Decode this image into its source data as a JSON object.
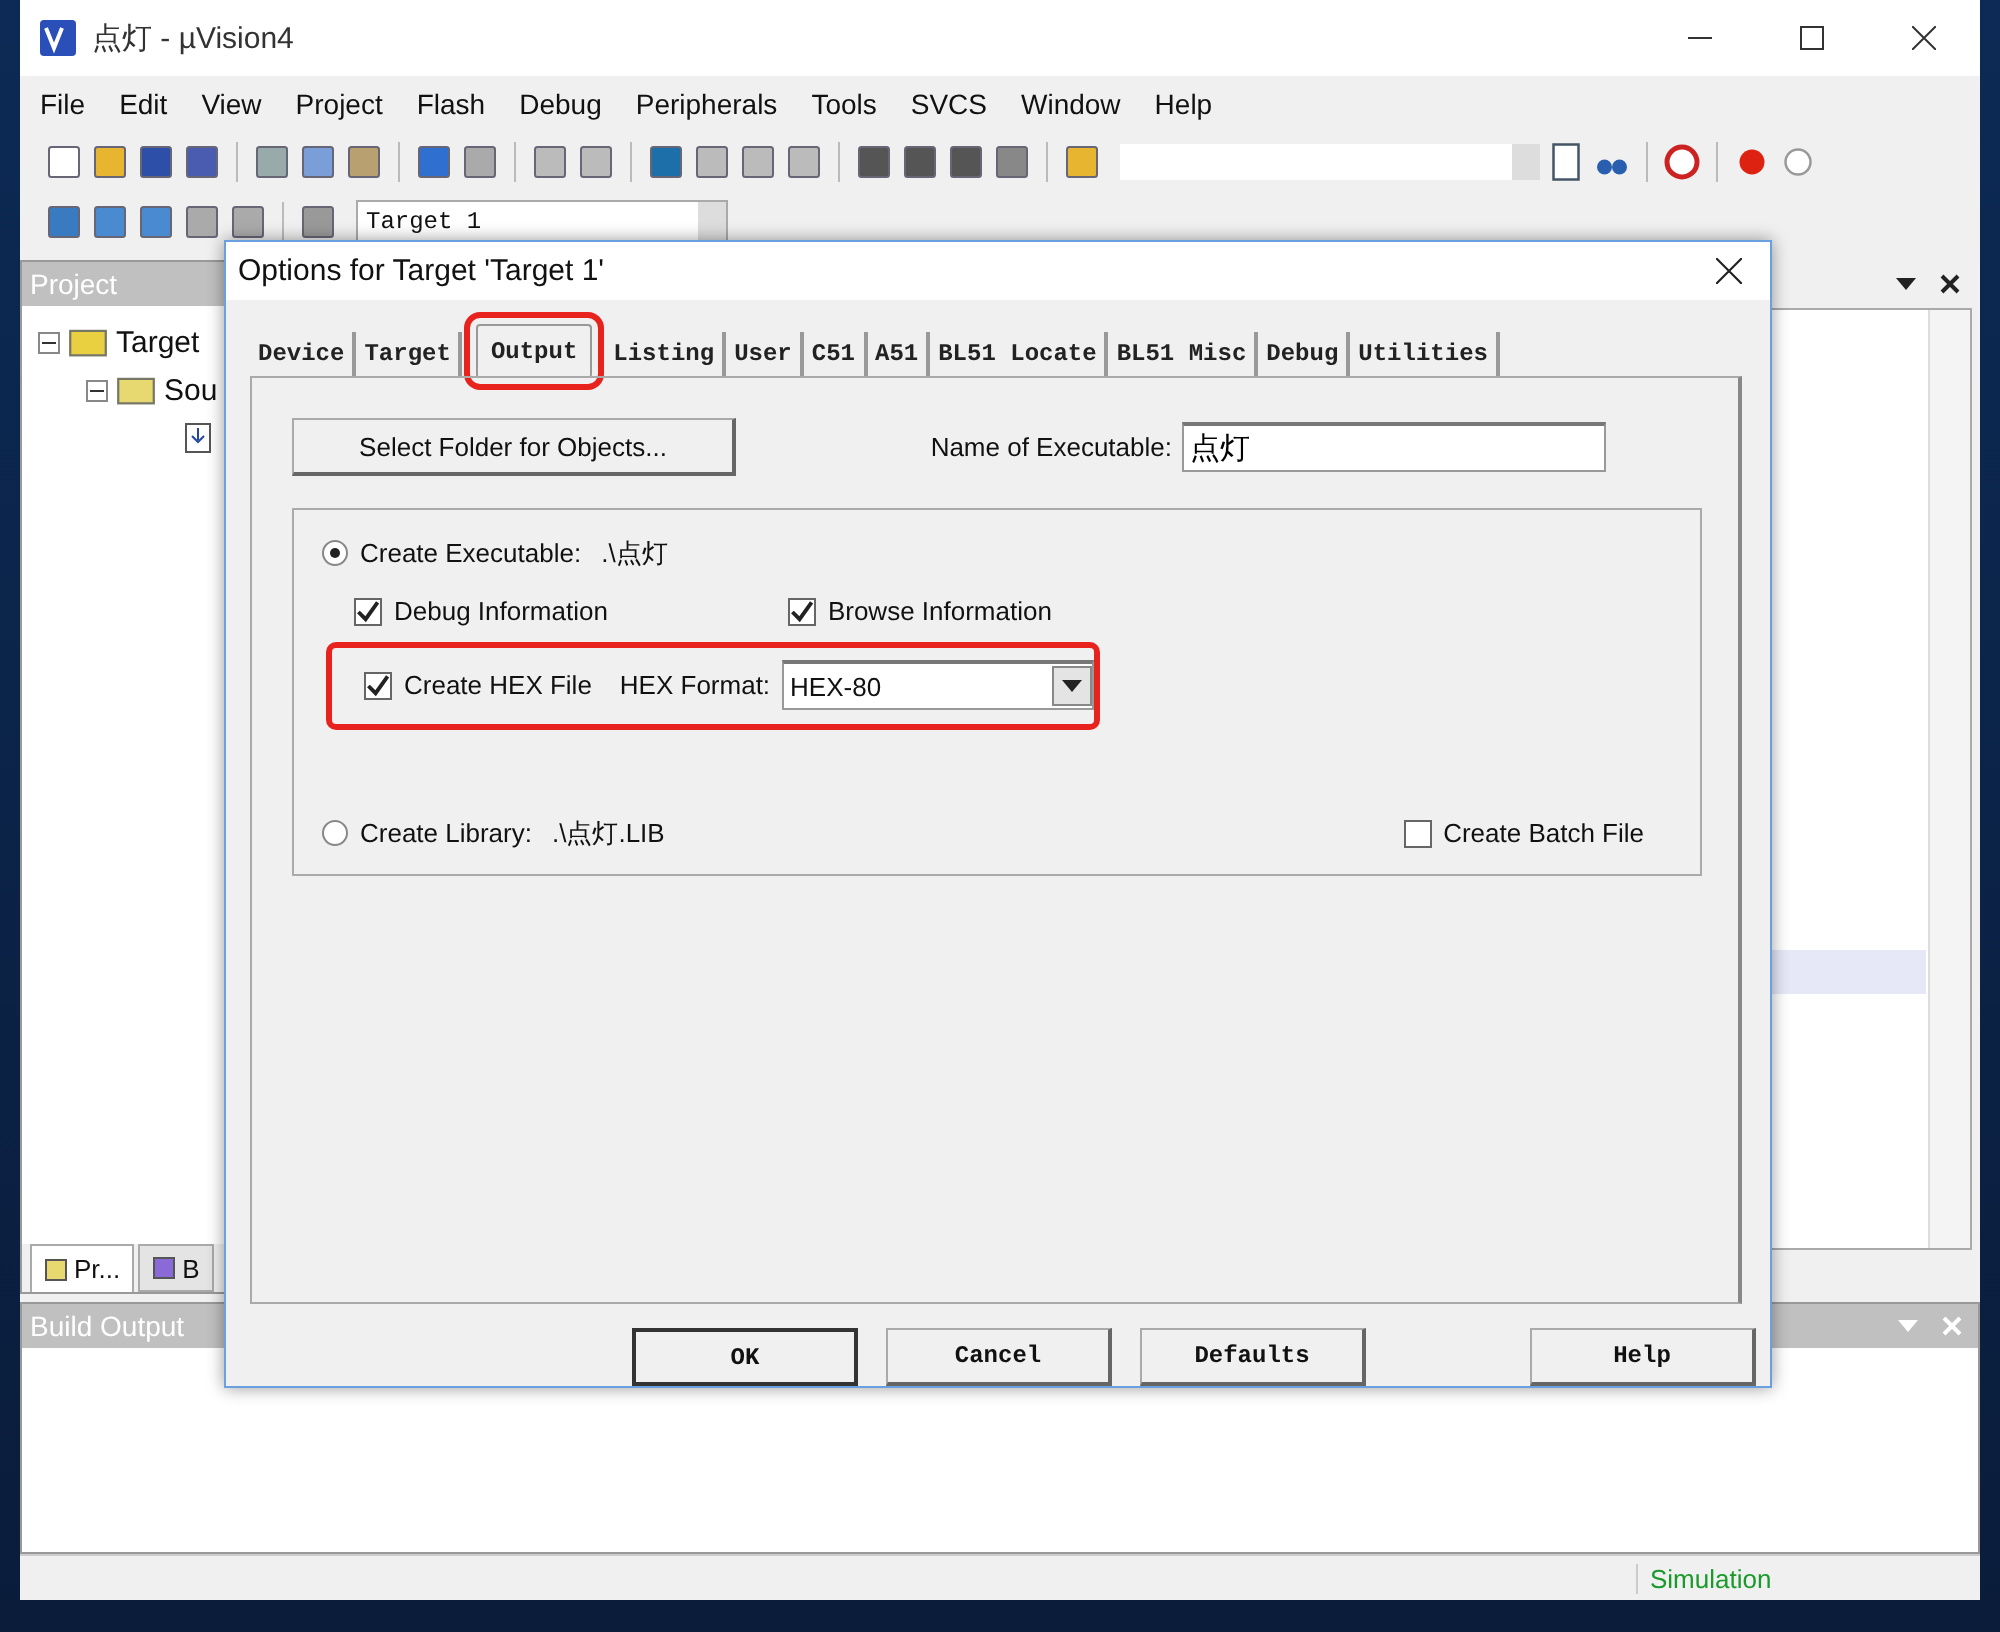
{
  "window": {
    "title": "点灯  - µVision4"
  },
  "menu": [
    "File",
    "Edit",
    "View",
    "Project",
    "Flash",
    "Debug",
    "Peripherals",
    "Tools",
    "SVCS",
    "Window",
    "Help"
  ],
  "toolbar": {
    "target": "Target 1"
  },
  "project": {
    "title": "Project",
    "tree": [
      {
        "label": "Target",
        "kind": "target",
        "expanded": true,
        "children": [
          {
            "label": "Sou",
            "kind": "group",
            "expanded": true,
            "children": [
              {
                "kind": "file"
              }
            ]
          }
        ]
      }
    ],
    "tabs": [
      {
        "label": "Pr...",
        "selected": true
      },
      {
        "label": "B",
        "selected": false
      }
    ]
  },
  "build_output": {
    "title": "Build Output"
  },
  "status_bar": {
    "mode": "Simulation"
  },
  "dialog": {
    "title": "Options for Target 'Target 1'",
    "tabs": [
      {
        "label": "Device",
        "selected": false,
        "highlighted": false
      },
      {
        "label": "Target",
        "selected": false,
        "highlighted": false
      },
      {
        "label": "Output",
        "selected": true,
        "highlighted": true
      },
      {
        "label": "Listing",
        "selected": false,
        "highlighted": false
      },
      {
        "label": "User",
        "selected": false,
        "highlighted": false
      },
      {
        "label": "C51",
        "selected": false,
        "highlighted": false
      },
      {
        "label": "A51",
        "selected": false,
        "highlighted": false
      },
      {
        "label": "BL51 Locate",
        "selected": false,
        "highlighted": false
      },
      {
        "label": "BL51 Misc",
        "selected": false,
        "highlighted": false
      },
      {
        "label": "Debug",
        "selected": false,
        "highlighted": false
      },
      {
        "label": "Utilities",
        "selected": false,
        "highlighted": false
      }
    ],
    "folder_button": "Select Folder for Objects...",
    "executable_label": "Name of Executable:",
    "executable_value": "点灯",
    "create_executable": {
      "label": "Create Executable:",
      "path": ".\\点灯",
      "selected": true
    },
    "debug_info": {
      "label": "Debug Information",
      "checked": true
    },
    "browse_info": {
      "label": "Browse Information",
      "checked": true
    },
    "hex_row": {
      "highlighted": true,
      "checkbox": {
        "label": "Create HEX File",
        "checked": true
      },
      "format_label": "HEX Format:",
      "format_value": "HEX-80"
    },
    "create_library": {
      "label": "Create Library:",
      "path": ".\\点灯.LIB",
      "selected": false
    },
    "batch_file": {
      "label": "Create Batch File",
      "checked": false
    },
    "buttons": [
      "OK",
      "Cancel",
      "Defaults",
      "Help"
    ]
  }
}
